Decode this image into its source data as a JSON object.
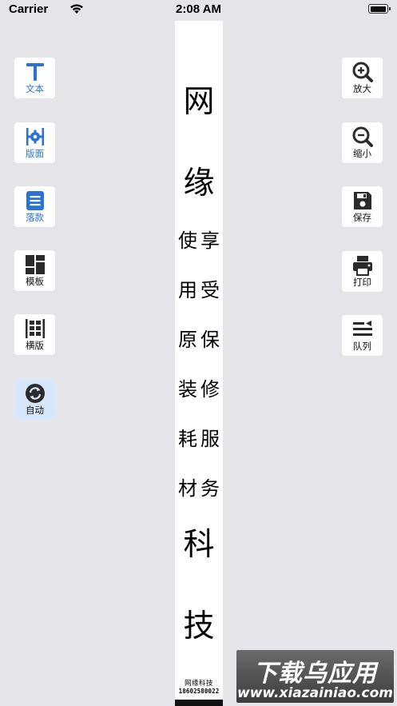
{
  "status_bar": {
    "carrier": "Carrier",
    "time": "2:08 AM"
  },
  "left_tools": [
    {
      "label": "文本",
      "icon": "text-icon"
    },
    {
      "label": "版面",
      "icon": "layout-gear-icon"
    },
    {
      "label": "落款",
      "icon": "inscription-icon"
    },
    {
      "label": "模板",
      "icon": "template-grid-icon"
    },
    {
      "label": "横版",
      "icon": "horizontal-layout-icon"
    },
    {
      "label": "自动",
      "icon": "refresh-icon"
    }
  ],
  "right_tools": [
    {
      "label": "放大",
      "icon": "zoom-in-icon"
    },
    {
      "label": "缩小",
      "icon": "zoom-out-icon"
    },
    {
      "label": "保存",
      "icon": "save-icon"
    },
    {
      "label": "打印",
      "icon": "print-icon"
    },
    {
      "label": "队列",
      "icon": "queue-icon"
    }
  ],
  "scroll": {
    "chars": {
      "c1": "网",
      "c2": "缘",
      "s1": "享",
      "s2": "受",
      "s3": "保",
      "s4": "修",
      "s5": "服",
      "s6": "务",
      "t1": "使",
      "t2": "用",
      "t3": "原",
      "t4": "装",
      "t5": "耗",
      "t6": "材",
      "c3": "科",
      "c4": "技"
    },
    "signature": "网缘科技",
    "phone": "18602580022"
  },
  "watermark": {
    "title": "下载乌应用",
    "url": "www.xiazainiao.com"
  },
  "colors": {
    "background": "#e4e4e9",
    "accent_blue": "#2a72d8",
    "active_bg": "#d7e7fb"
  }
}
